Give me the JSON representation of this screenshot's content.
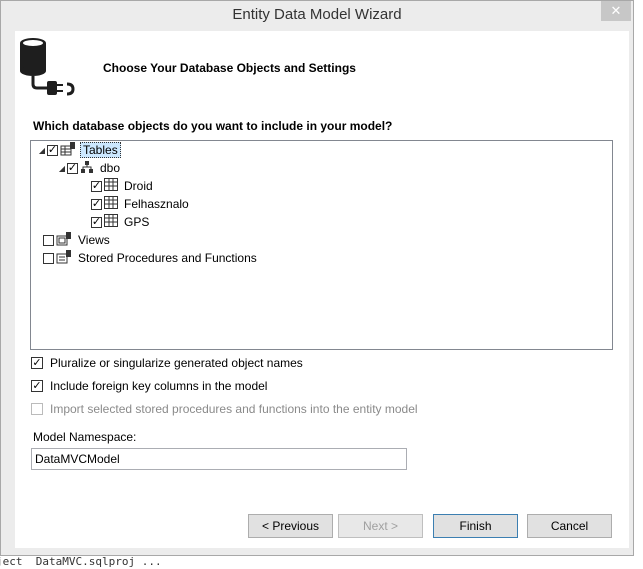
{
  "window": {
    "title": "Entity Data Model Wizard",
    "close_glyph": "✕"
  },
  "header": {
    "title": "Choose Your Database Objects and Settings"
  },
  "question": "Which database objects do you want to include in your model?",
  "tree": {
    "tables": {
      "label": "Tables",
      "checked": true,
      "expanded": true
    },
    "schema": {
      "label": "dbo",
      "checked": true,
      "expanded": true
    },
    "table_items": [
      {
        "label": "Droid",
        "checked": true
      },
      {
        "label": "Felhasznalo",
        "checked": true
      },
      {
        "label": "GPS",
        "checked": true
      }
    ],
    "views": {
      "label": "Views",
      "checked": false
    },
    "procedures": {
      "label": "Stored Procedures and Functions",
      "checked": false
    }
  },
  "options": {
    "pluralize": {
      "label": "Pluralize or singularize generated object names",
      "checked": true
    },
    "foreign_keys": {
      "label": "Include foreign key columns in the model",
      "checked": true
    },
    "import_procs": {
      "label": "Import selected stored procedures and functions into the entity model",
      "checked": false,
      "disabled": true
    }
  },
  "namespace": {
    "label": "Model Namespace:",
    "value": "DataMVCModel"
  },
  "buttons": {
    "previous": "< Previous",
    "next": "Next >",
    "finish": "Finish",
    "cancel": "Cancel"
  },
  "background": {
    "bottom_text": "ject  DataMVC.sqlproj ...",
    "bottom_e": "e"
  }
}
